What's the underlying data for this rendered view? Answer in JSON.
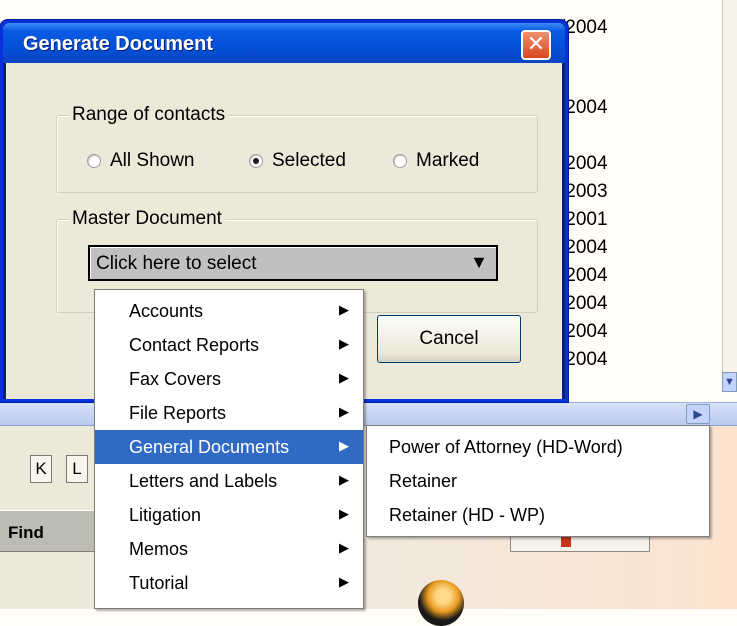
{
  "background": {
    "dates": [
      "/2004",
      "/2004",
      "/2004",
      "/2003",
      "/2001",
      "/2004",
      "/2004",
      "/2004",
      "/2004",
      "/2004"
    ],
    "toolbar_letters": [
      "K",
      "L"
    ],
    "find_label": "Find"
  },
  "dialog": {
    "title": "Generate Document",
    "close_glyph": "✕",
    "range_group": {
      "label": "Range of contacts",
      "options": [
        "All Shown",
        "Selected",
        "Marked"
      ],
      "selected": "Selected"
    },
    "master_group": {
      "label": "Master Document",
      "select_value": "Click here to select"
    },
    "cancel_label": "Cancel"
  },
  "menu": {
    "items": [
      "Accounts",
      "Contact Reports",
      "Fax Covers",
      "File Reports",
      "General Documents",
      "Letters and Labels",
      "Litigation",
      "Memos",
      "Tutorial"
    ],
    "highlighted": "General Documents"
  },
  "submenu": {
    "items": [
      "Power of Attorney (HD-Word)",
      "Retainer",
      "Retainer (HD - WP)"
    ]
  }
}
